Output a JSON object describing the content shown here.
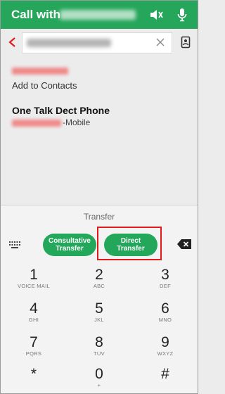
{
  "header": {
    "title": "Call with"
  },
  "search": {
    "clear_icon": "close-icon"
  },
  "results": {
    "add_to_contacts": "Add to Contacts",
    "contact_name": "One Talk Dect Phone",
    "contact_type": "-Mobile"
  },
  "keypad": {
    "transfer_label": "Transfer",
    "consult_label_1": "Consultative",
    "consult_label_2": "Transfer",
    "direct_label_1": "Direct",
    "direct_label_2": "Transfer",
    "keys": [
      {
        "num": "1",
        "sub": "VOICE MAIL"
      },
      {
        "num": "2",
        "sub": "ABC"
      },
      {
        "num": "3",
        "sub": "DEF"
      },
      {
        "num": "4",
        "sub": "GHI"
      },
      {
        "num": "5",
        "sub": "JKL"
      },
      {
        "num": "6",
        "sub": "MNO"
      },
      {
        "num": "7",
        "sub": "PQRS"
      },
      {
        "num": "8",
        "sub": "TUV"
      },
      {
        "num": "9",
        "sub": "WXYZ"
      },
      {
        "num": "*",
        "sub": ""
      },
      {
        "num": "0",
        "sub": "+"
      },
      {
        "num": "#",
        "sub": ""
      }
    ]
  },
  "colors": {
    "accent": "#26a65b",
    "highlight": "#e11a1a",
    "redacted": "#ef8a8a"
  }
}
